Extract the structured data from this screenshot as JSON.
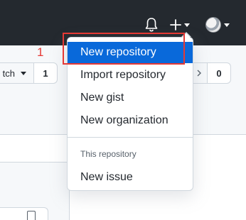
{
  "header": {
    "bell_icon": "bell-icon",
    "create_icon": "plus-icon",
    "avatar_icon": "user-avatar"
  },
  "repo_actions": {
    "watch_label": "tch",
    "watch_count": "1",
    "star_count": "0"
  },
  "menu": {
    "items": [
      {
        "label": "New repository",
        "active": true
      },
      {
        "label": "Import repository"
      },
      {
        "label": "New gist"
      },
      {
        "label": "New organization"
      }
    ],
    "section_header": "This repository",
    "section_items": [
      {
        "label": "New issue"
      }
    ],
    "active_color": "#0969da"
  },
  "annotation": {
    "number": "1",
    "color": "#e53935"
  }
}
